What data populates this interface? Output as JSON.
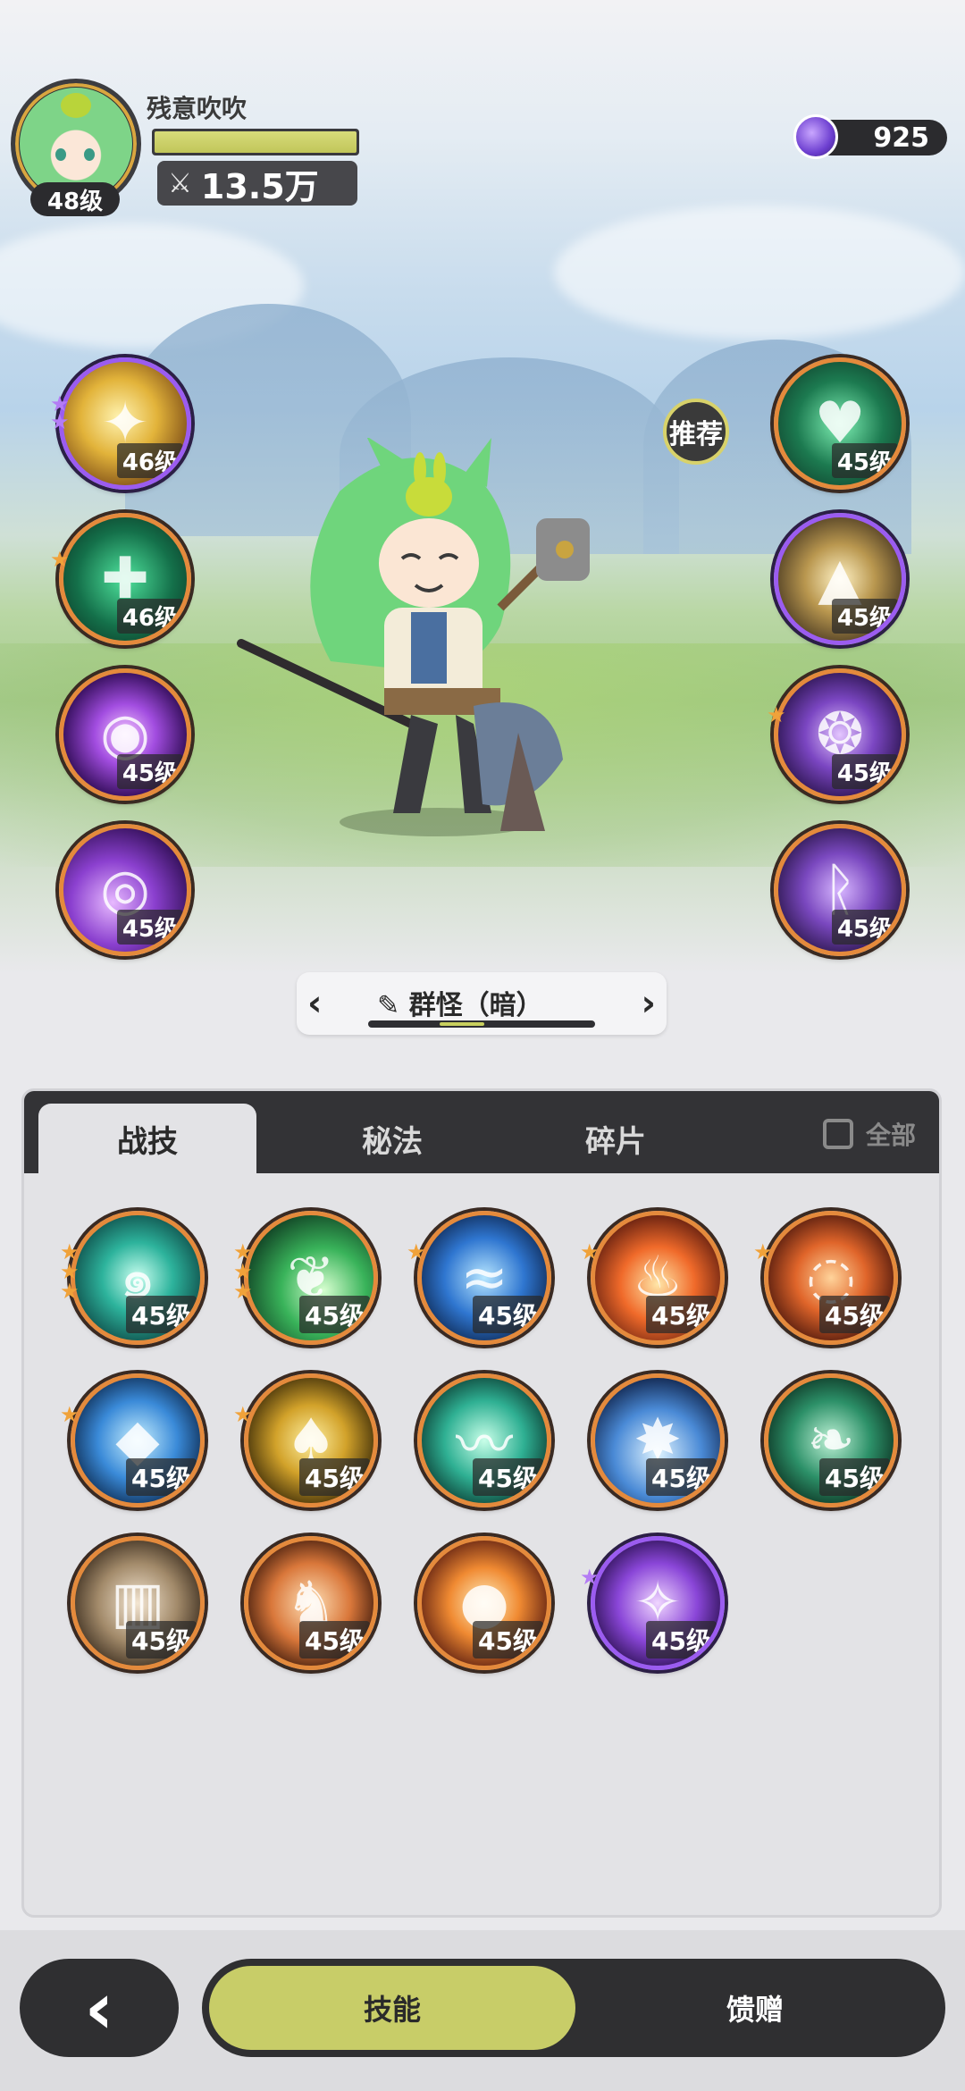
{
  "player": {
    "name": "残意吹吹",
    "level": "48级",
    "power": "13.5万"
  },
  "currency": {
    "gem_count": "925",
    "icon": "purple-gem-icon"
  },
  "recommend_label": "推荐",
  "left_skills": [
    {
      "level": "46级",
      "theme": "gold-sparkle",
      "star": "purple",
      "star_count": 2
    },
    {
      "level": "46级",
      "theme": "green-cross",
      "star": "orange",
      "star_count": 1
    },
    {
      "level": "45级",
      "theme": "purple-eye",
      "star": null,
      "star_count": 0
    },
    {
      "level": "45级",
      "theme": "purple-vortex",
      "star": null,
      "star_count": 0
    }
  ],
  "right_skills": [
    {
      "level": "45级",
      "theme": "green-heart",
      "star": null,
      "star_count": 0
    },
    {
      "level": "45级",
      "theme": "gold-arrow",
      "star": null,
      "star_count": 0
    },
    {
      "level": "45级",
      "theme": "purple-seal",
      "star": "orange",
      "star_count": 1
    },
    {
      "level": "45级",
      "theme": "purple-rune",
      "star": null,
      "star_count": 0
    }
  ],
  "preset": {
    "label": "群怪（暗）",
    "prev": "‹",
    "next": "›"
  },
  "tabs": [
    {
      "label": "战技",
      "active": true
    },
    {
      "label": "秘法",
      "active": false
    },
    {
      "label": "碎片",
      "active": false
    }
  ],
  "all_toggle": {
    "label": "全部",
    "checked": false
  },
  "grid_skills": [
    {
      "level": "45级",
      "theme": "teal-swirl",
      "stars": 3,
      "star": "orange"
    },
    {
      "level": "45级",
      "theme": "green-flame",
      "stars": 3,
      "star": "orange"
    },
    {
      "level": "45级",
      "theme": "blue-wave",
      "stars": 1,
      "star": "orange"
    },
    {
      "level": "45级",
      "theme": "red-fire",
      "stars": 1,
      "star": "orange"
    },
    {
      "level": "45级",
      "theme": "orange-ring",
      "stars": 1,
      "star": "orange"
    },
    {
      "level": "45级",
      "theme": "ice-shard",
      "stars": 1,
      "star": "orange"
    },
    {
      "level": "45级",
      "theme": "gold-spade",
      "stars": 1,
      "star": "orange"
    },
    {
      "level": "45级",
      "theme": "teal-slash",
      "stars": 0,
      "star": null
    },
    {
      "level": "45级",
      "theme": "blue-splash",
      "stars": 0,
      "star": null
    },
    {
      "level": "45级",
      "theme": "green-thorn",
      "stars": 0,
      "star": null
    },
    {
      "level": "45级",
      "theme": "stone-tablet",
      "stars": 0,
      "star": null
    },
    {
      "level": "45级",
      "theme": "fire-wolf",
      "stars": 0,
      "star": null
    },
    {
      "level": "45级",
      "theme": "fire-orb",
      "stars": 0,
      "star": null
    },
    {
      "level": "45级",
      "theme": "purple-diamond",
      "stars": 1,
      "star": "purple"
    }
  ],
  "bottom_nav": {
    "back_icon": "‹",
    "skill_label": "技能",
    "gift_label": "馈赠"
  }
}
